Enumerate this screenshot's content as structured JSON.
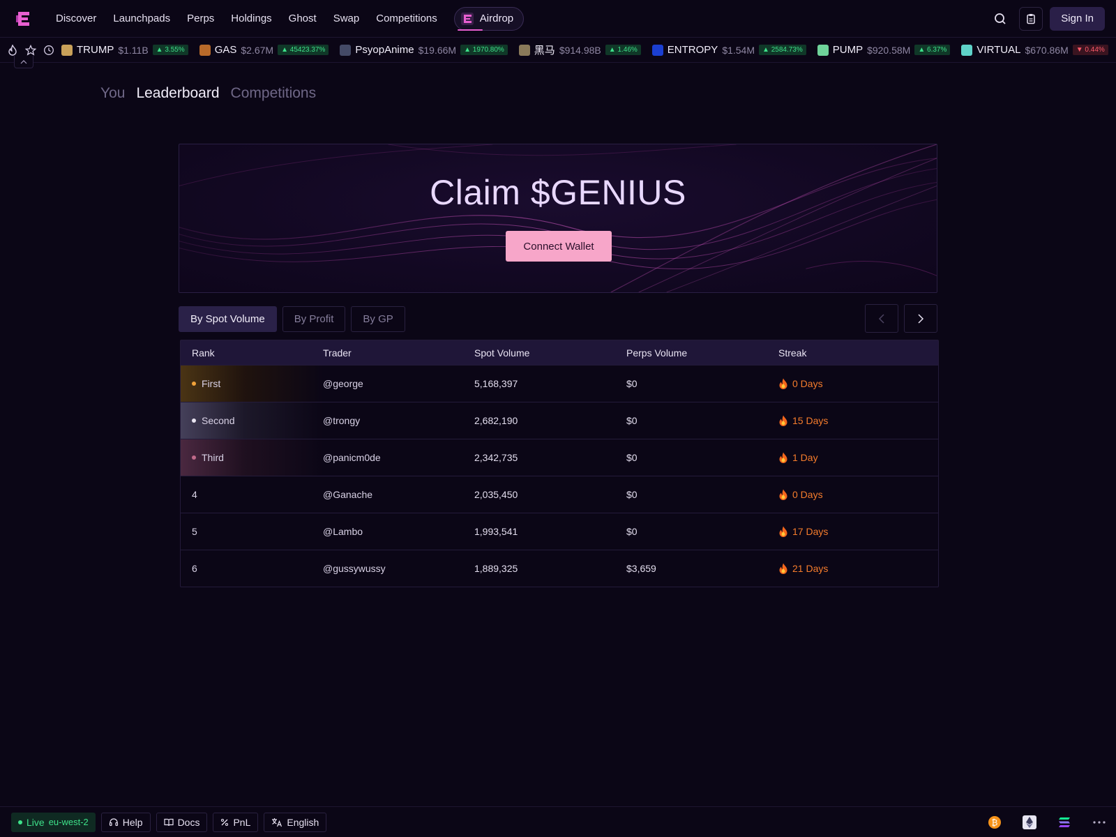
{
  "nav": {
    "items": [
      "Discover",
      "Launchpads",
      "Perps",
      "Holdings",
      "Ghost",
      "Swap",
      "Competitions"
    ],
    "airdrop_label": "Airdrop",
    "signin_label": "Sign In"
  },
  "ticker": [
    {
      "symbol": "TRUMP",
      "mcap": "$1.11B",
      "change": "▲ 3.55%",
      "dir": "up",
      "icon_color": "#c9a15a"
    },
    {
      "symbol": "GAS",
      "mcap": "$2.67M",
      "change": "▲ 45423.37%",
      "dir": "up",
      "icon_color": "#b86a2a"
    },
    {
      "symbol": "PsyopAnime",
      "mcap": "$19.66M",
      "change": "▲ 1970.80%",
      "dir": "up",
      "icon_color": "#444a66"
    },
    {
      "symbol": "黑马",
      "mcap": "$914.98B",
      "change": "▲ 1.46%",
      "dir": "up",
      "icon_color": "#8a7a5a"
    },
    {
      "symbol": "ENTROPY",
      "mcap": "$1.54M",
      "change": "▲ 2584.73%",
      "dir": "up",
      "icon_color": "#1b3fd1"
    },
    {
      "symbol": "PUMP",
      "mcap": "$920.58M",
      "change": "▲ 6.37%",
      "dir": "up",
      "icon_color": "#6fd39a"
    },
    {
      "symbol": "VIRTUAL",
      "mcap": "$670.86M",
      "change": "▼ 0.44%",
      "dir": "down",
      "icon_color": "#5fd3c9"
    }
  ],
  "page_tabs": [
    "You",
    "Leaderboard",
    "Competitions"
  ],
  "banner": {
    "title": "Claim $GENIUS",
    "connect_label": "Connect Wallet"
  },
  "filters": [
    "By Spot Volume",
    "By Profit",
    "By GP"
  ],
  "table": {
    "headers": [
      "Rank",
      "Trader",
      "Spot Volume",
      "Perps Volume",
      "Streak"
    ],
    "rows": [
      {
        "rank": "First",
        "trader": "@george",
        "spot": "5,168,397",
        "perps": "$0",
        "streak": "0 Days"
      },
      {
        "rank": "Second",
        "trader": "@trongy",
        "spot": "2,682,190",
        "perps": "$0",
        "streak": "15 Days"
      },
      {
        "rank": "Third",
        "trader": "@panicm0de",
        "spot": "2,342,735",
        "perps": "$0",
        "streak": "1 Day"
      },
      {
        "rank": "4",
        "trader": "@Ganache",
        "spot": "2,035,450",
        "perps": "$0",
        "streak": "0 Days"
      },
      {
        "rank": "5",
        "trader": "@Lambo",
        "spot": "1,993,541",
        "perps": "$0",
        "streak": "17 Days"
      },
      {
        "rank": "6",
        "trader": "@gussywussy",
        "spot": "1,889,325",
        "perps": "$3,659",
        "streak": "21 Days"
      }
    ]
  },
  "footer": {
    "live_label": "Live",
    "region": "eu-west-2",
    "help_label": "Help",
    "docs_label": "Docs",
    "pnl_label": "PnL",
    "language_label": "English"
  },
  "colors": {
    "accent": "#e85fd0",
    "connect_button": "#f7a6c9",
    "streak": "#f57c2c",
    "up": "#3ee28a",
    "down": "#ff5a6a"
  }
}
